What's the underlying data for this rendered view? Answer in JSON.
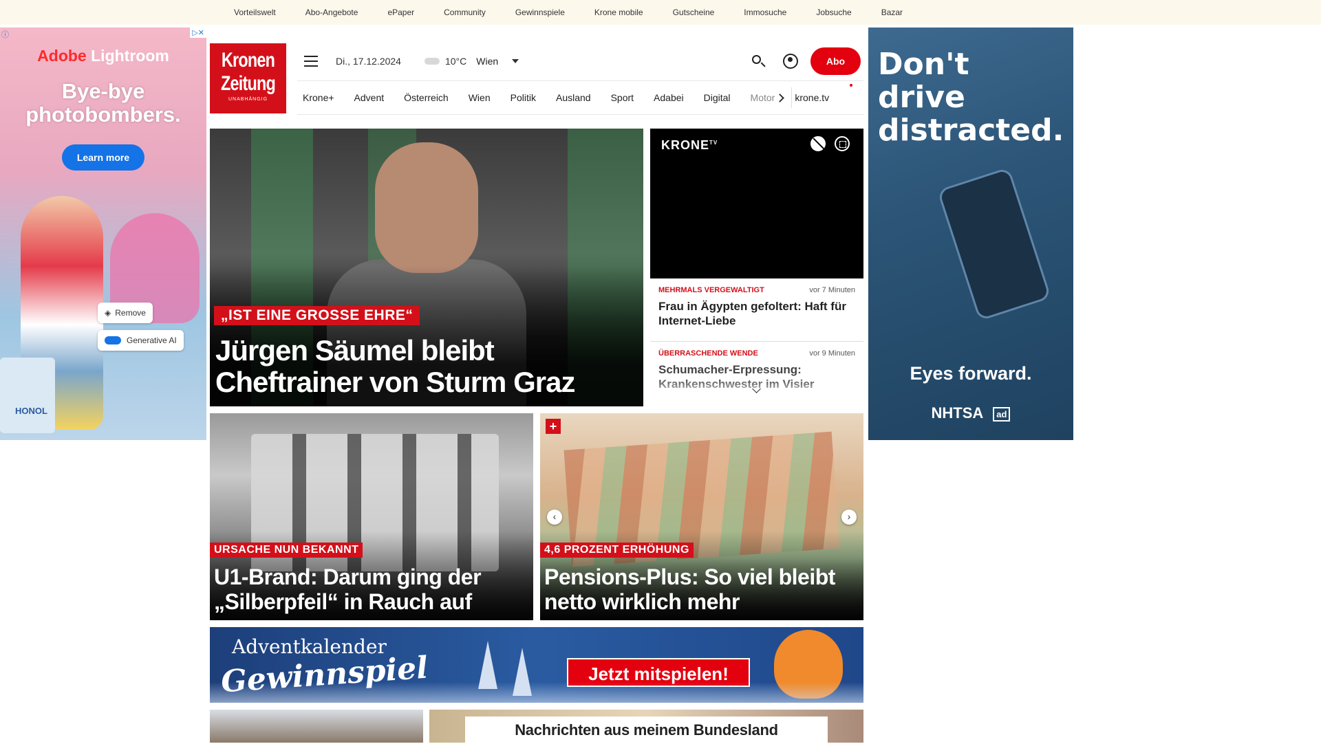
{
  "topbar": {
    "links": [
      "Vorteilswelt",
      "Abo-Angebote",
      "ePaper",
      "Community",
      "Gewinnspiele",
      "Krone mobile",
      "Gutscheine",
      "Immosuche",
      "Jobsuche",
      "Bazar"
    ]
  },
  "ad_left": {
    "brand_adobe": "Adobe",
    "brand_product": "Lightroom",
    "headline_1": "Bye-bye",
    "headline_2": "photobombers.",
    "cta": "Learn more",
    "chip_remove": "Remove",
    "chip_generative": "Generative AI",
    "can_text": "HONOL"
  },
  "ad_right": {
    "headline": "Don't drive distracted.",
    "subline": "Eyes forward.",
    "logo_nhtsa": "NHTSA",
    "logo_ad": "ad"
  },
  "header": {
    "logo_line1": "Kronen",
    "logo_line2": "Zeitung",
    "logo_tagline": "UNABHÄNGIG",
    "date": "Di., 17.12.2024",
    "temperature": "10°C",
    "city": "Wien",
    "abo_label": "Abo"
  },
  "nav": {
    "items": [
      "Krone+",
      "Advent",
      "Österreich",
      "Wien",
      "Politik",
      "Ausland",
      "Sport",
      "Adabei",
      "Digital",
      "Motor"
    ],
    "tv": "krone.tv"
  },
  "hero": {
    "kicker": "„IST EINE GROSSE EHRE“",
    "title": "Jürgen Säumel bleibt Cheftrainer von Sturm Graz"
  },
  "video": {
    "brand": "KRONE",
    "brand_sup": "TV"
  },
  "side_news": [
    {
      "category": "MEHRMALS VERGEWALTIGT",
      "time": "vor 7 Minuten",
      "headline": "Frau in Ägypten gefoltert: Haft für Internet-Liebe"
    },
    {
      "category": "ÜBERRASCHENDE WENDE",
      "time": "vor 9 Minuten",
      "headline": "Schumacher-Erpressung: Krankenschwester im Visier"
    }
  ],
  "cards": [
    {
      "kicker": "URSACHE NUN BEKANNT",
      "title": "U1-Brand: Darum ging der „Silberpfeil“ in Rauch auf"
    },
    {
      "kicker": "4,6 PROZENT ERHÖHUNG",
      "title": "Pensions-Plus: So viel bleibt netto wirklich mehr",
      "plus": "+"
    }
  ],
  "banner": {
    "line1": "Adventkalender",
    "line2": "Gewinnspiel",
    "cta": "Jetzt mitspielen!"
  },
  "bottom": {
    "bundesland": "Nachrichten aus meinem Bundesland"
  },
  "colors": {
    "brand_red": "#d3101a",
    "abo_red": "#e3000f",
    "topbar_bg": "#fdf8ec"
  }
}
